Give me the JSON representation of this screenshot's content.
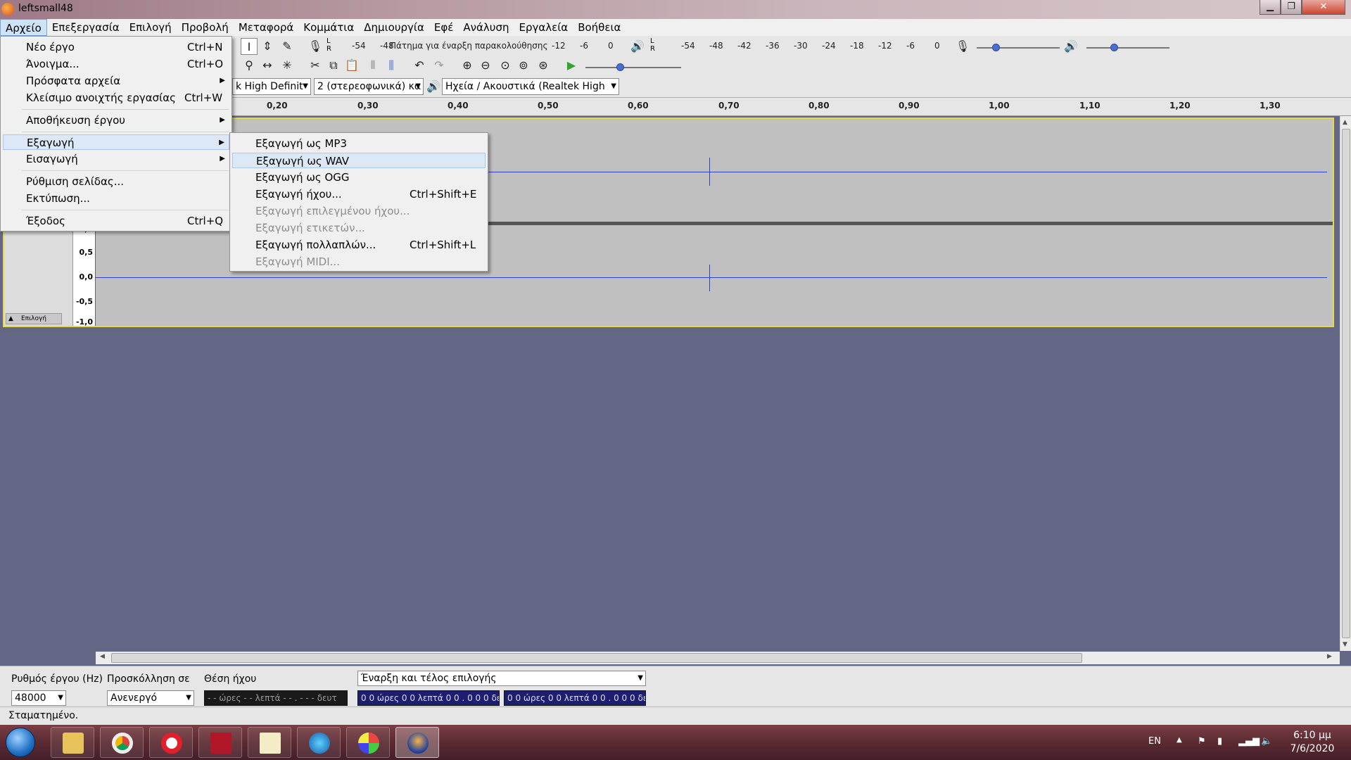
{
  "window": {
    "title": "leftsmall48"
  },
  "menubar": [
    "Αρχείο",
    "Επεξεργασία",
    "Επιλογή",
    "Προβολή",
    "Μεταφορά",
    "Κομμάτια",
    "Δημιουργία",
    "Εφέ",
    "Ανάλυση",
    "Εργαλεία",
    "Βοήθεια"
  ],
  "file_menu": {
    "items": [
      {
        "label": "Νέο έργο",
        "shortcut": "Ctrl+N"
      },
      {
        "label": "Άνοιγμα...",
        "shortcut": "Ctrl+O"
      },
      {
        "label": "Πρόσφατα αρχεία",
        "shortcut": ""
      },
      {
        "label": "Κλείσιμο ανοιχτής εργασίας",
        "shortcut": "Ctrl+W"
      },
      {
        "label": "Αποθήκευση έργου",
        "shortcut": ""
      },
      {
        "label": "Εξαγωγή",
        "shortcut": ""
      },
      {
        "label": "Εισαγωγή",
        "shortcut": ""
      },
      {
        "label": "Ρύθμιση σελίδας...",
        "shortcut": ""
      },
      {
        "label": "Εκτύπωση...",
        "shortcut": ""
      },
      {
        "label": "Έξοδος",
        "shortcut": "Ctrl+Q"
      }
    ]
  },
  "export_menu": {
    "items": [
      {
        "label": "Εξαγωγή ως MP3",
        "shortcut": ""
      },
      {
        "label": "Εξαγωγή ως WAV",
        "shortcut": ""
      },
      {
        "label": "Εξαγωγή ως OGG",
        "shortcut": ""
      },
      {
        "label": "Εξαγωγή ήχου...",
        "shortcut": "Ctrl+Shift+E"
      },
      {
        "label": "Εξαγωγή επιλεγμένου ήχου...",
        "shortcut": ""
      },
      {
        "label": "Εξαγωγή ετικετών...",
        "shortcut": ""
      },
      {
        "label": "Εξαγωγή πολλαπλών...",
        "shortcut": "Ctrl+Shift+L"
      },
      {
        "label": "Εξαγωγή MIDI...",
        "shortcut": ""
      }
    ]
  },
  "toolbar": {
    "record_meter_scale": [
      "-54",
      "-48",
      "Πάτημα για έναρξη παρακολούθησης",
      "-12",
      "-6",
      "0"
    ],
    "playback_meter_scale": [
      "-54",
      "-48",
      "-42",
      "-36",
      "-30",
      "-24",
      "-18",
      "-12",
      "-6",
      "0"
    ],
    "lr_label": "L R",
    "recording_device": "k High Definit",
    "channels": "2 (στερεοφωνικά) κα",
    "playback_device": "Ηχεία / Ακουστικά (Realtek High"
  },
  "ruler": [
    "0,20",
    "0,30",
    "0,40",
    "0,50",
    "0,60",
    "0,70",
    "0,80",
    "0,90",
    "1,00",
    "1,10",
    "1,20",
    "1,30"
  ],
  "track": {
    "scale_lower": [
      "1,0",
      "0,5",
      "0,0",
      "-0,5",
      "-1,0"
    ],
    "select_button": "Επιλογή"
  },
  "selection_bar": {
    "project_rate_label": "Ρυθμός έργου (Hz)",
    "project_rate_value": "48000",
    "snap_label": "Προσκόλληση σε",
    "snap_value": "Ανενεργό",
    "audio_position_label": "Θέση ήχου",
    "audio_position_value": "- - ώρες - - λεπτά - - . - - - δευτ",
    "selection_mode_value": "Έναρξη και τέλος επιλογής",
    "selection_start": "0 0 ώρες 0 0 λεπτά 0 0 . 0 0 0 δευτ",
    "selection_end": "0 0 ώρες 0 0 λεπτά 0 0 . 0 0 0 δευτ"
  },
  "status": {
    "text": "Σταματημένο."
  },
  "taskbar": {
    "language": "EN",
    "time": "6:10 μμ",
    "date": "7/6/2020"
  }
}
